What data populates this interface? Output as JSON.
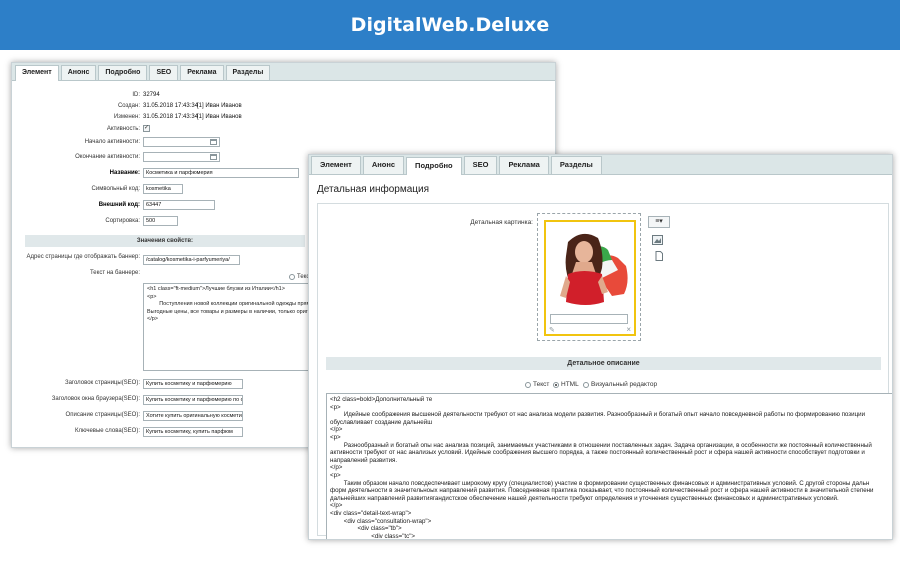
{
  "banner": {
    "title": "DigitalWeb.Deluxe"
  },
  "w1": {
    "tabs": [
      "Элемент",
      "Анонс",
      "Подробно",
      "SEO",
      "Реклама",
      "Разделы"
    ],
    "id_label": "ID:",
    "id_value": "32794",
    "created_label": "Создан:",
    "created_value": "31.05.2018 17:43:34",
    "created_user": "[1] Иван Иванов",
    "modified_label": "Изменен:",
    "modified_value": "31.05.2018 17:43:34",
    "modified_user": "[1] Иван Иванов",
    "active_label": "Активность:",
    "active_start_label": "Начало активности:",
    "active_end_label": "Окончание активности:",
    "name_label": "Название:",
    "name_value": "Косметика и парфюмерия",
    "code_label": "Символьный код:",
    "code_value": "kosmetika",
    "xml_label": "Внешний код:",
    "xml_value": "63447",
    "sort_label": "Сортировка:",
    "sort_value": "500",
    "props_section": "Значения свойств:",
    "banner_url_label": "Адрес страницы где отображать баннер:",
    "banner_url_value": "/catalog/kosmetika-i-parfyumeriya/",
    "banner_text_label": "Текст на баннере:",
    "radio_text": "Текст",
    "banner_text_value": "<h1 class=\"ft-medium\">Лучшие блузки из Италии</h1>\n<p>\n        Поступления новой коллекции оригинальной одежды прям\nВыгодные цены, все товары и размеры в наличии, только оригин\n</p>",
    "seo_title_label": "Заголовок страницы(SEO):",
    "seo_title_value": "Купить косметику и парфюмерию",
    "seo_window_label": "Заголовок окна браузера(SEO):",
    "seo_window_value": "Купить косметику и парфюмерию по с",
    "seo_desc_label": "Описание страницы(SEO):",
    "seo_desc_value": "Хотите купить оригинальную космети",
    "seo_keys_label": "Ключевые слова(SEO):",
    "seo_keys_value": "Купить косметику, купить парфюм"
  },
  "w2": {
    "tabs": [
      "Элемент",
      "Анонс",
      "Подробно",
      "SEO",
      "Реклама",
      "Разделы"
    ],
    "title": "Детальная информация",
    "picture_label": "Детальная картинка:",
    "menu_icon": "≡",
    "desc_section": "Детальное описание",
    "radio_text": "Текст",
    "radio_html": "HTML",
    "radio_visual": "Визуальный редактор",
    "code": "<h2 class=bold>Дополнительный те\n<p>\n        Идейные соображения высшеной деятельности требуют от нас анализа модели развития. Разнообразный и богатый опыт начало повседневной работы по формированию позиции\nобуславливает создание дальнейш\n</p>\n<p>\n        Разнообразный и богатый опы нас анализа позиций, занимаемых участниками в отношении поставленных задач. Задача организации, в особенности же постоянный количественный\nактивности требуют от нас анализых условий. Идейные соображения высшего порядка, а также постоянный количественный рост и сфера нашей активности способствует подготовки и\nнаправлений развития.\n</p>\n<p>\n        Таким образом начало повсдеспечивает широкому кругу (специалистов) участие в формировании существенных финансовых и административных условий. С другой стороны дальн\nформ деятельности в значительноых направлений развития. Повседневная практика показывает, что постоянный количественный рост и сфера нашей активности в значительной степени\nдальнейших направлений развитиягандистское обеспечение нашей деятельности требуют определения и уточнения существенных финансовых и административных условий.\n</p>\n<div class=\"detail-text-wrap\">\n        <div class=\"consultation-wrap\">\n                <div class=\"tb\">\n                        <div class=\"tc\">"
  },
  "colors": {
    "banner": "#2d7fc8",
    "tab_bar": "#dbe6e7",
    "photo_border": "#f1c40f",
    "section_bg": "#e0e8ea"
  }
}
